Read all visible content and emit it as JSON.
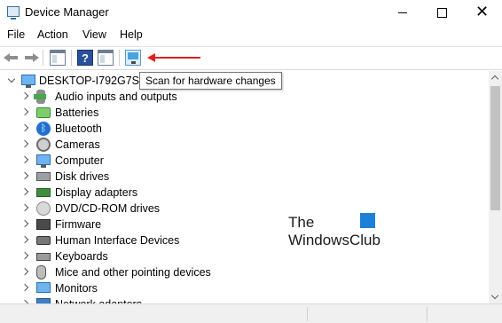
{
  "window": {
    "title": "Device Manager",
    "close_glyph": "✕"
  },
  "menu": [
    "File",
    "Action",
    "View",
    "Help"
  ],
  "toolbar": {
    "help_glyph": "?"
  },
  "tooltip": "Scan for hardware changes",
  "tree": {
    "root": "DESKTOP-I792G7S",
    "items": [
      "Audio inputs and outputs",
      "Batteries",
      "Bluetooth",
      "Cameras",
      "Computer",
      "Disk drives",
      "Display adapters",
      "DVD/CD-ROM drives",
      "Firmware",
      "Human Interface Devices",
      "Keyboards",
      "Mice and other pointing devices",
      "Monitors",
      "Network adapters"
    ]
  },
  "watermark": {
    "line1": "The",
    "line2": "WindowsClub"
  },
  "colors": {
    "accent_arrow": "#e02020",
    "tooltip_border": "#767676"
  }
}
